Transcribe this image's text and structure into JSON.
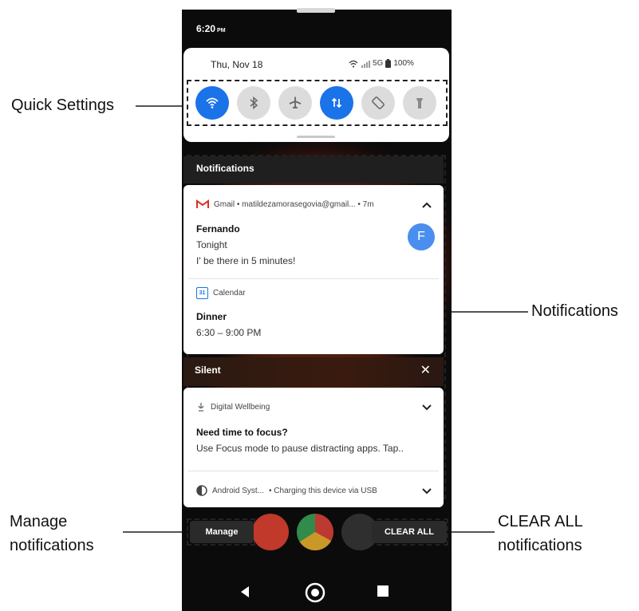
{
  "status_bar": {
    "time": "6:20",
    "ampm": "PM"
  },
  "quick_settings": {
    "date": "Thu, Nov 18",
    "network": "5G",
    "battery": "100%",
    "tiles": [
      {
        "icon": "wifi-icon",
        "state": "on"
      },
      {
        "icon": "bluetooth-icon",
        "state": "off"
      },
      {
        "icon": "airplane-icon",
        "state": "off"
      },
      {
        "icon": "mobile-data-icon",
        "state": "on"
      },
      {
        "icon": "auto-rotate-icon",
        "state": "off"
      },
      {
        "icon": "flashlight-icon",
        "state": "off"
      }
    ]
  },
  "notifications": {
    "header": "Notifications",
    "gmail": {
      "app": "Gmail • matildezamorasegovia@gmail... • 7m",
      "sender": "Fernando",
      "subject": "Tonight",
      "body": "I' be there in 5 minutes!",
      "avatar": "F"
    },
    "calendar": {
      "app": "Calendar",
      "badge": "31",
      "title": "Dinner",
      "time": "6:30 – 9:00 PM"
    }
  },
  "silent": {
    "header": "Silent",
    "close": "✕",
    "wellbeing": {
      "app": "Digital Wellbeing",
      "title": "Need time to focus?",
      "body": "Use Focus mode to pause distracting apps. Tap.."
    },
    "android": {
      "app": "Android Syst...",
      "body": "• Charging this device via USB"
    }
  },
  "buttons": {
    "manage": "Manage",
    "clear_all": "CLEAR ALL"
  },
  "callouts": {
    "quick_settings": "Quick Settings",
    "notifications": "Notifications",
    "manage_line1": "Manage",
    "manage_line2": "notifications",
    "clear_line1": "CLEAR ALL",
    "clear_line2": "notifications"
  },
  "colors": {
    "accent": "#1a73e8",
    "tile_off": "#dcdcdc",
    "avatar": "#4a8ef0",
    "gmail_red": "#d93025"
  }
}
